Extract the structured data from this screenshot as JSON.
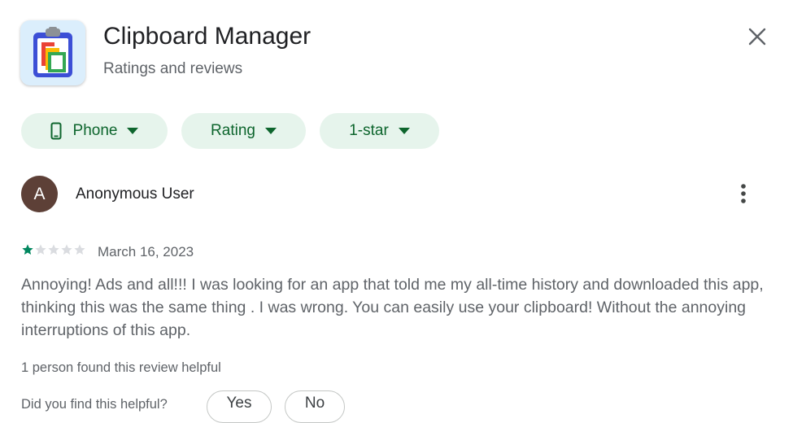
{
  "header": {
    "app_title": "Clipboard Manager",
    "subtitle": "Ratings and reviews",
    "app_icon": "clipboard-icon",
    "close_icon": "close-icon"
  },
  "filters": [
    {
      "label": "Phone",
      "icon": "phone-icon"
    },
    {
      "label": "Rating"
    },
    {
      "label": "1-star"
    }
  ],
  "review": {
    "avatar_initial": "A",
    "author": "Anonymous User",
    "rating": 1,
    "max_rating": 5,
    "date": "March 16, 2023",
    "text": "Annoying! Ads and all!!! I was looking for an app that told me my all-time history and downloaded this app, thinking this was the same thing . I was wrong. You can easily use your clipboard! Without the annoying interruptions of this app.",
    "helpful_count_text": "1 person found this review helpful",
    "helpful_question": "Did you find this helpful?",
    "yes_label": "Yes",
    "no_label": "No"
  },
  "colors": {
    "chip_background": "#e6f4ec",
    "chip_text": "#0d652d",
    "star_filled": "#01875f",
    "star_empty": "#dadce0",
    "avatar_background": "#5d4037"
  }
}
